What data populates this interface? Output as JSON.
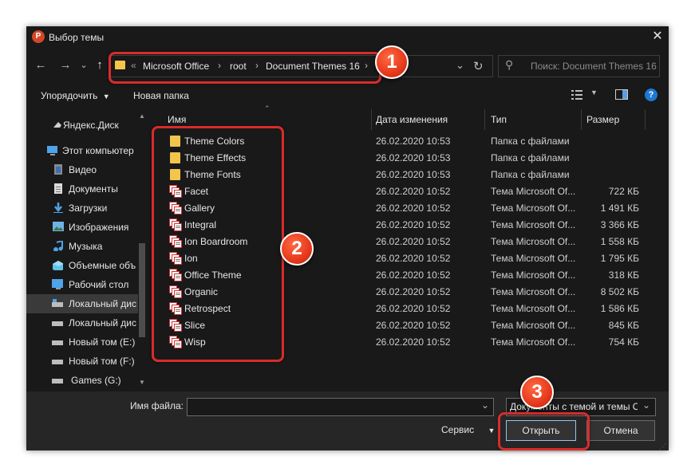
{
  "window": {
    "title": "Выбор темы",
    "app_icon_letter": "P"
  },
  "address": {
    "root_chevron": "«",
    "crumbs": [
      "Microsoft Office",
      "root",
      "Document Themes 16"
    ],
    "sep": "›",
    "dropdown": "⌄",
    "refresh": "↻"
  },
  "search": {
    "placeholder": "Поиск: Document Themes 16"
  },
  "toolbar": {
    "organize": "Упорядочить",
    "new_folder": "Новая папка",
    "help": "?"
  },
  "sidebar": [
    {
      "label": "Яндекс.Диск",
      "icon": "cloud-icon"
    },
    {
      "label": "Этот компьютер",
      "icon": "computer-icon"
    },
    {
      "label": "Видео",
      "icon": "video-icon"
    },
    {
      "label": "Документы",
      "icon": "documents-icon"
    },
    {
      "label": "Загрузки",
      "icon": "downloads-icon"
    },
    {
      "label": "Изображения",
      "icon": "images-icon"
    },
    {
      "label": "Музыка",
      "icon": "music-icon"
    },
    {
      "label": "Объемные объ",
      "icon": "3d-objects-icon"
    },
    {
      "label": "Рабочий стол",
      "icon": "desktop-icon"
    },
    {
      "label": "Локальный дис",
      "icon": "drive-icon"
    },
    {
      "label": "Локальный дис",
      "icon": "drive-icon"
    },
    {
      "label": "Новый том (E:)",
      "icon": "drive-icon"
    },
    {
      "label": "Новый том (F:)",
      "icon": "drive-icon"
    },
    {
      "label": "Games (G:)",
      "icon": "drive-icon"
    }
  ],
  "columns": {
    "name": "Имя",
    "date": "Дата изменения",
    "type": "Тип",
    "size": "Размер"
  },
  "files": [
    {
      "name": "Theme Colors",
      "date": "26.02.2020 10:53",
      "type": "Папка с файлами",
      "size": "",
      "kind": "folder"
    },
    {
      "name": "Theme Effects",
      "date": "26.02.2020 10:53",
      "type": "Папка с файлами",
      "size": "",
      "kind": "folder"
    },
    {
      "name": "Theme Fonts",
      "date": "26.02.2020 10:53",
      "type": "Папка с файлами",
      "size": "",
      "kind": "folder"
    },
    {
      "name": "Facet",
      "date": "26.02.2020 10:52",
      "type": "Тема Microsoft Of...",
      "size": "722 КБ",
      "kind": "theme"
    },
    {
      "name": "Gallery",
      "date": "26.02.2020 10:52",
      "type": "Тема Microsoft Of...",
      "size": "1 491 КБ",
      "kind": "theme"
    },
    {
      "name": "Integral",
      "date": "26.02.2020 10:52",
      "type": "Тема Microsoft Of...",
      "size": "3 366 КБ",
      "kind": "theme"
    },
    {
      "name": "Ion Boardroom",
      "date": "26.02.2020 10:52",
      "type": "Тема Microsoft Of...",
      "size": "1 558 КБ",
      "kind": "theme"
    },
    {
      "name": "Ion",
      "date": "26.02.2020 10:52",
      "type": "Тема Microsoft Of...",
      "size": "1 795 КБ",
      "kind": "theme"
    },
    {
      "name": "Office Theme",
      "date": "26.02.2020 10:52",
      "type": "Тема Microsoft Of...",
      "size": "318 КБ",
      "kind": "theme"
    },
    {
      "name": "Organic",
      "date": "26.02.2020 10:52",
      "type": "Тема Microsoft Of...",
      "size": "8 502 КБ",
      "kind": "theme"
    },
    {
      "name": "Retrospect",
      "date": "26.02.2020 10:52",
      "type": "Тема Microsoft Of...",
      "size": "1 586 КБ",
      "kind": "theme"
    },
    {
      "name": "Slice",
      "date": "26.02.2020 10:52",
      "type": "Тема Microsoft Of...",
      "size": "845 КБ",
      "kind": "theme"
    },
    {
      "name": "Wisp",
      "date": "26.02.2020 10:52",
      "type": "Тема Microsoft Of...",
      "size": "754 КБ",
      "kind": "theme"
    }
  ],
  "footer": {
    "filename_label": "Имя файла:",
    "filename_value": "",
    "filter_value": "Документы с темой и темы O",
    "service": "Сервис",
    "open": "Открыть",
    "cancel": "Отмена"
  },
  "callouts": [
    "1",
    "2",
    "3"
  ],
  "colors": {
    "callout": "#d92b2b",
    "badge": "#e6391c",
    "folder": "#f3c54b",
    "window_bg": "#191919"
  }
}
